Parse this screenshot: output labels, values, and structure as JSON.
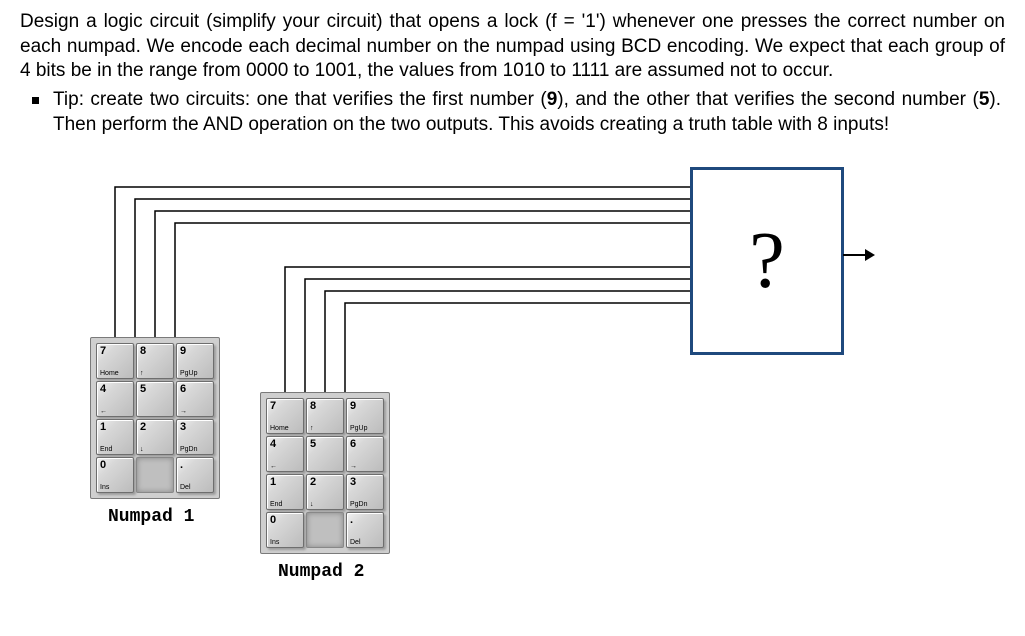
{
  "problem": "Design a logic circuit (simplify your circuit) that opens a lock (f = '1') whenever one presses the correct number on each numpad. We encode each decimal number on the numpad using BCD encoding. We expect that each group of 4 bits be in the range from 0000 to 1001, the values from 1010 to 1111 are assumed not to occur.",
  "tip_prefix": "Tip: create two circuits: one that verifies the first number (",
  "tip_num1": "9",
  "tip_mid": "), and the other that verifies the second number (",
  "tip_num2": "5",
  "tip_suffix": "). Then perform the AND operation on the two outputs. This avoids creating a truth table with 8 inputs!",
  "question": "?",
  "numpad1_label": "Numpad  1",
  "numpad2_label": "Numpad  2",
  "keys": {
    "r0": [
      {
        "main": "7",
        "sub": "Home"
      },
      {
        "main": "8",
        "sub": "↑"
      },
      {
        "main": "9",
        "sub": "PgUp"
      }
    ],
    "r1": [
      {
        "main": "4",
        "sub": "←"
      },
      {
        "main": "5",
        "sub": ""
      },
      {
        "main": "6",
        "sub": "→"
      }
    ],
    "r2": [
      {
        "main": "1",
        "sub": "End"
      },
      {
        "main": "2",
        "sub": "↓"
      },
      {
        "main": "3",
        "sub": "PgDn"
      }
    ],
    "r3": [
      {
        "main": "0",
        "sub": "Ins"
      },
      {
        "empty": true
      },
      {
        "main": ".",
        "sub": "Del"
      }
    ]
  }
}
